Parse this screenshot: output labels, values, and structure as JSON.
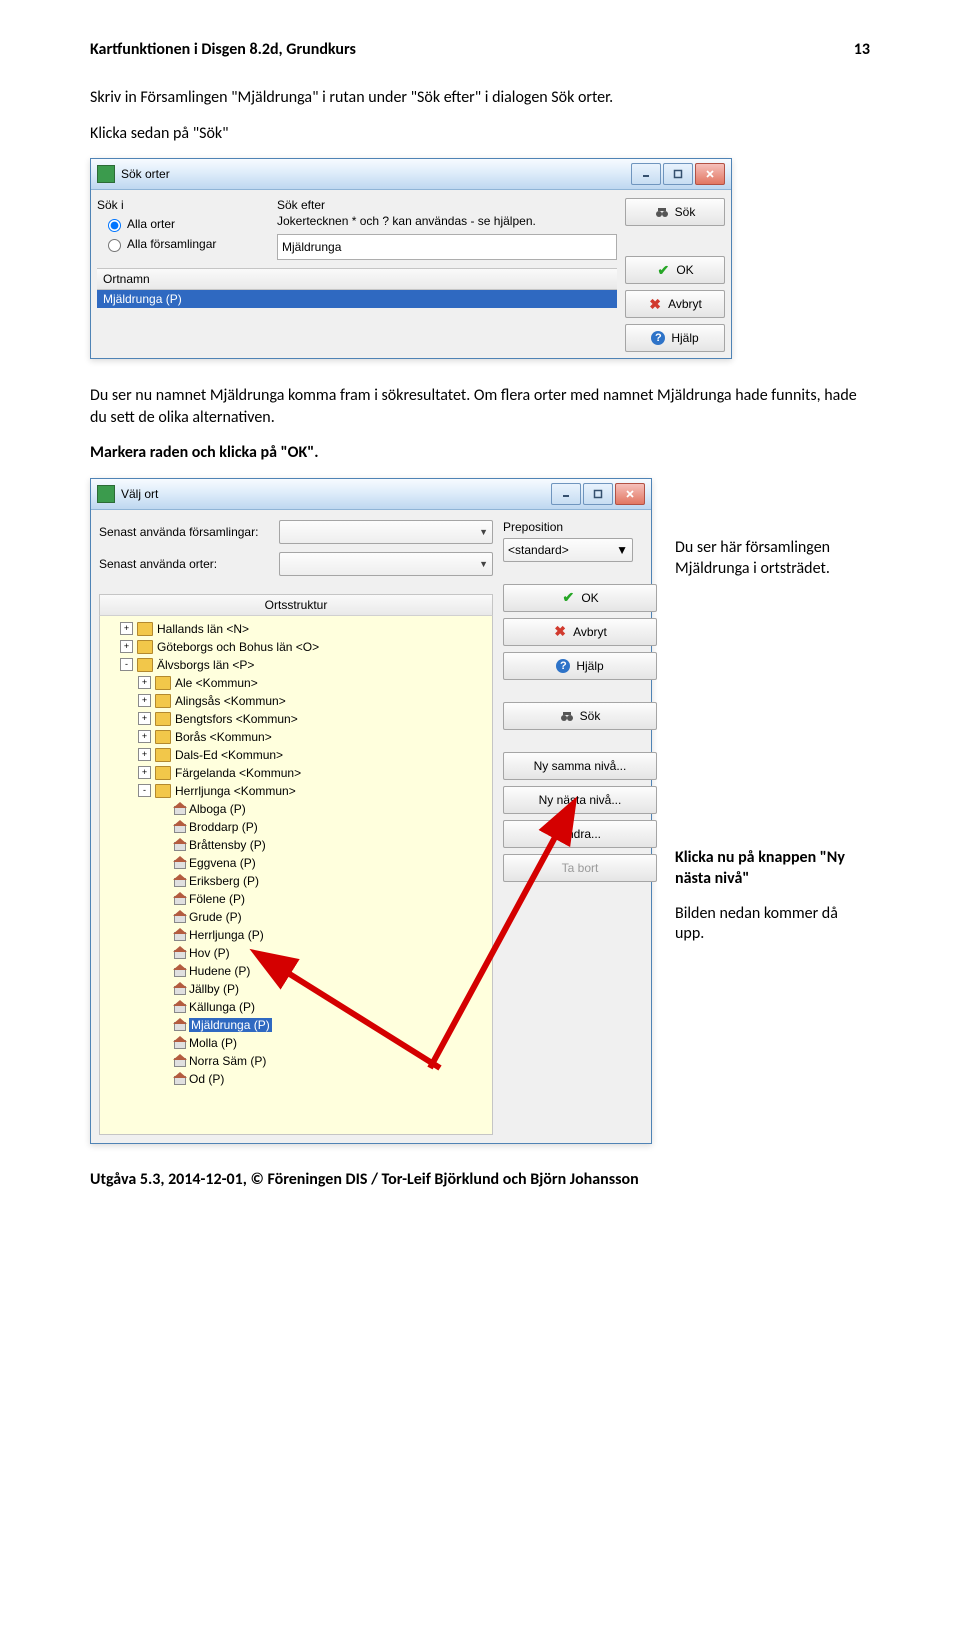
{
  "header": {
    "left": "Kartfunktionen i Disgen 8.2d, Grundkurs",
    "right": "13"
  },
  "intro1": "Skriv in Församlingen \"Mjäldrunga\" i rutan under \"Sök efter\" i dialogen Sök orter.",
  "intro2": "Klicka sedan på \"Sök\"",
  "dlg1": {
    "title": "Sök orter",
    "labels": {
      "sok_i": "Sök i",
      "sok_efter": "Sök efter"
    },
    "radios": {
      "alla_orter": "Alla orter",
      "alla_forsamlingar": "Alla församlingar"
    },
    "joker": "Jokertecknen * och ? kan användas - se hjälpen.",
    "value": "Mjäldrunga",
    "th": "Ortnamn",
    "result": "Mjäldrunga (P)",
    "buttons": {
      "sok": "Sök",
      "ok": "OK",
      "avbryt": "Avbryt",
      "hjalp": "Hjälp"
    }
  },
  "mid1": "Du ser nu namnet Mjäldrunga komma fram i sökresultatet. Om flera orter med namnet Mjäldrunga hade funnits, hade du sett de olika alternativen.",
  "mid2": "Markera raden och klicka på \"OK\".",
  "dlg2": {
    "title": "Välj ort",
    "senast_fors": "Senast använda församlingar:",
    "senast_orter": "Senast använda orter:",
    "tree_header": "Ortsstruktur",
    "preposition_label": "Preposition",
    "preposition_value": "<standard>",
    "buttons": {
      "ok": "OK",
      "avbryt": "Avbryt",
      "hjalp": "Hjälp",
      "sok": "Sök",
      "ny_samma": "Ny samma nivå...",
      "ny_nasta": "Ny nästa nivå...",
      "andra": "Ändra...",
      "ta_bort": "Ta bort"
    },
    "tree": {
      "top": [
        "Hallands län <N>",
        "Göteborgs och Bohus län <O>",
        "Älvsborgs län <P>"
      ],
      "kommuner": [
        "Ale <Kommun>",
        "Alingsås <Kommun>",
        "Bengtsfors <Kommun>",
        "Borås <Kommun>",
        "Dals-Ed <Kommun>",
        "Färgelanda <Kommun>",
        "Herrljunga <Kommun>"
      ],
      "forsamlingar": [
        "Alboga (P)",
        "Broddarp (P)",
        "Bråttensby (P)",
        "Eggvena (P)",
        "Eriksberg (P)",
        "Fölene (P)",
        "Grude (P)",
        "Herrljunga (P)",
        "Hov (P)",
        "Hudene (P)",
        "Jällby (P)",
        "Källunga (P)",
        "Mjäldrunga (P)",
        "Molla (P)",
        "Norra Säm (P)",
        "Od (P)"
      ],
      "selected": "Mjäldrunga (P)"
    }
  },
  "side1": "Du ser här församlingen Mjäldrunga i ortsträdet.",
  "side2a": "Klicka nu på knappen \"Ny nästa nivå\"",
  "side2b": "Bilden nedan kommer då upp.",
  "footer": "Utgåva 5.3, 2014-12-01, © Föreningen DIS / Tor-Leif Björklund och Björn Johansson"
}
